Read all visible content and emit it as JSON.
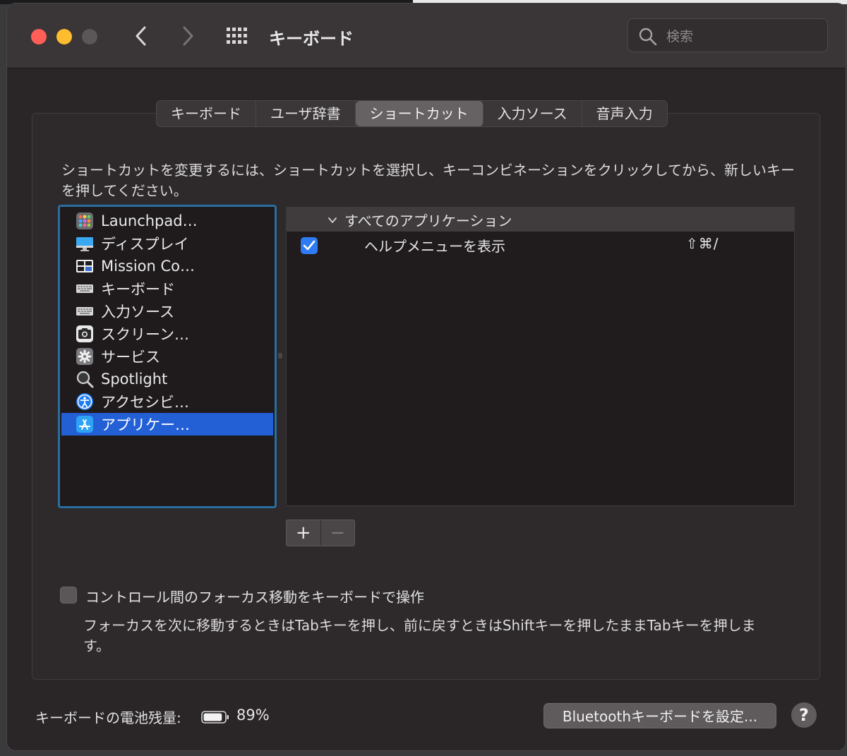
{
  "window": {
    "title": "キーボード",
    "search_placeholder": "検索"
  },
  "tabs": [
    {
      "label": "キーボード",
      "selected": false
    },
    {
      "label": "ユーザ辞書",
      "selected": false
    },
    {
      "label": "ショートカット",
      "selected": true
    },
    {
      "label": "入力ソース",
      "selected": false
    },
    {
      "label": "音声入力",
      "selected": false
    }
  ],
  "instructions": "ショートカットを変更するには、ショートカットを選択し、キーコンビネーションをクリックしてから、新しいキーを押してください。",
  "categories": [
    {
      "label": "Launchpad…",
      "icon": "launchpad-icon",
      "selected": false
    },
    {
      "label": "ディスプレイ",
      "icon": "display-icon",
      "selected": false
    },
    {
      "label": "Mission Co…",
      "icon": "mission-control-icon",
      "selected": false
    },
    {
      "label": "キーボード",
      "icon": "keyboard-icon",
      "selected": false
    },
    {
      "label": "入力ソース",
      "icon": "keyboard-icon",
      "selected": false
    },
    {
      "label": "スクリーン…",
      "icon": "screenshot-icon",
      "selected": false
    },
    {
      "label": "サービス",
      "icon": "gear-icon",
      "selected": false
    },
    {
      "label": "Spotlight",
      "icon": "magnifier-icon",
      "selected": false
    },
    {
      "label": "アクセシビ…",
      "icon": "accessibility-icon",
      "selected": false
    },
    {
      "label": "アプリケー…",
      "icon": "app-store-icon",
      "selected": true
    }
  ],
  "shortcuts": {
    "group_label": "すべてのアプリケーション",
    "rows": [
      {
        "name": "ヘルプメニューを表示",
        "keys": "⇧⌘/",
        "checked": true
      }
    ]
  },
  "buttons": {
    "add": "+",
    "remove": "−",
    "bluetooth": "Bluetoothキーボードを設定...",
    "help": "?"
  },
  "focus": {
    "label": "コントロール間のフォーカス移動をキーボードで操作",
    "checked": false,
    "description": "フォーカスを次に移動するときはTabキーを押し、前に戻すときはShiftキーを押したままTabキーを押します。"
  },
  "battery": {
    "label": "キーボードの電池残量:",
    "percent": "89%",
    "level": 0.89
  },
  "colors": {
    "accent": "#2360d6",
    "checkbox": "#2f7bf5",
    "close": "#ff5f57",
    "minimize": "#febc2e"
  }
}
